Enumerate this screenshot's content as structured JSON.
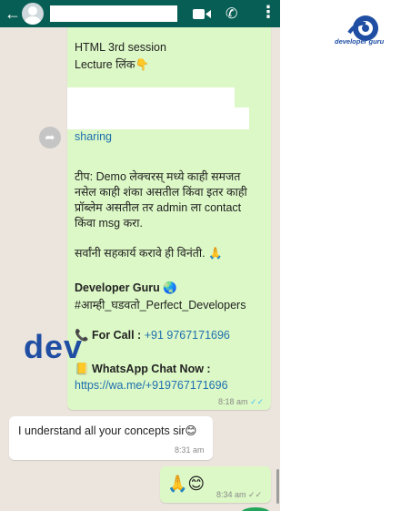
{
  "header": {
    "back_icon": "arrow-left-icon",
    "avatar_icon": "avatar-placeholder-icon",
    "video_icon": "videocam-icon",
    "call_icon": "phone-icon",
    "menu_icon": "more-vert-icon",
    "bar_color": "#075e54"
  },
  "chat": {
    "background": "#ece5dd",
    "outgoing_color": "#dcf8c6",
    "main_message": {
      "line1": "HTML 3rd session",
      "line2": "Lecture लिंक👇",
      "link_label": "sharing",
      "tip_line1": "टीप: Demo लेक्चरस् मध्ये काही समजत",
      "tip_line2": "नसेल काही शंका असतील किंवा इतर काही",
      "tip_line3": "प्रॉब्लेम असतील तर admin ला contact",
      "tip_line4": "किंवा msg करा.",
      "request": "सर्वांनी सहकार्य करावे ही विनंती. 🙏",
      "brand": "Developer Guru 🌏",
      "hashtag": "#आम्ही_घडवतो_Perfect_Developers",
      "call_label": "📞 For Call : ",
      "call_number": "+91 9767171696",
      "whatsapp_label": "📒 WhatsApp Chat Now :",
      "whatsapp_link": "https://wa.me/+919767171696",
      "time": "8:18 am",
      "ticks": "✓✓"
    },
    "incoming_message": {
      "text": "I understand all your concepts sir😊",
      "time": "8:31 am"
    },
    "reply_message": {
      "text": "🙏😊",
      "time": "8:34 am",
      "ticks": "✓✓"
    }
  },
  "watermark": {
    "text": "dev"
  },
  "logo": {
    "text": "developer guru",
    "color": "#1f4ea3"
  }
}
